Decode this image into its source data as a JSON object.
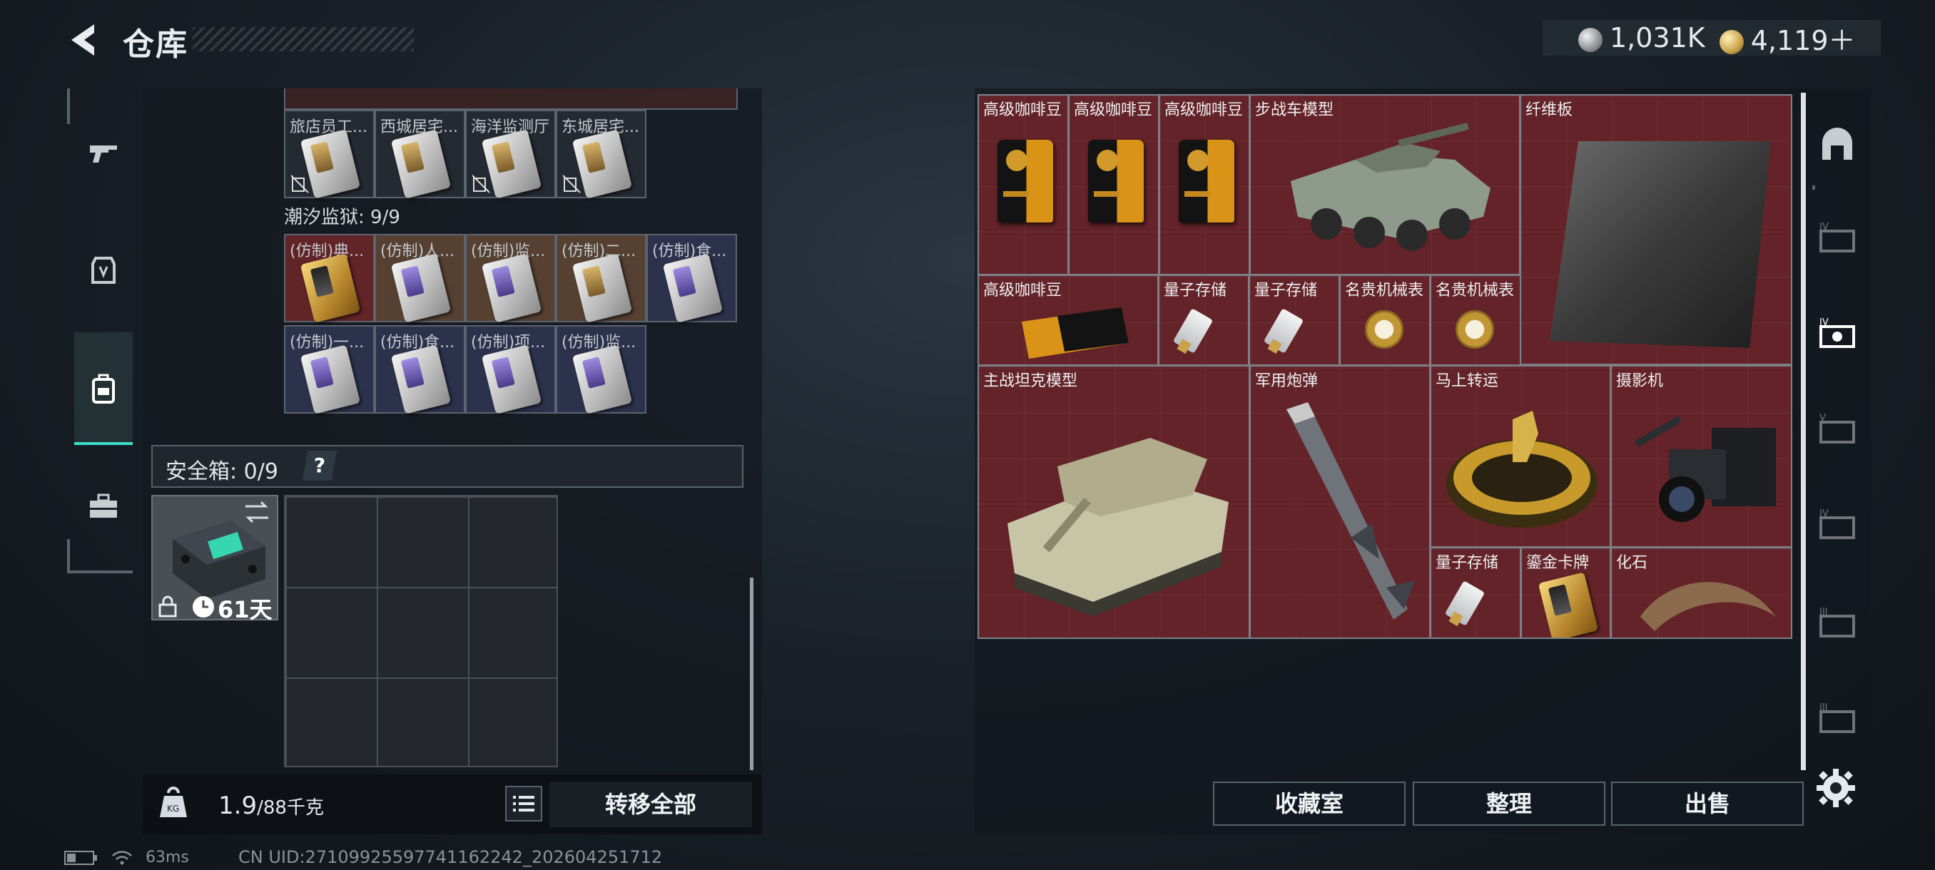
{
  "header": {
    "title": "仓库",
    "currency": [
      {
        "icon": "silver-coin-icon",
        "value": "1,031K"
      },
      {
        "icon": "gold-coin-icon",
        "value": "4,119＋"
      }
    ]
  },
  "nav": {
    "items": [
      {
        "name": "weapon",
        "icon": "gun-icon"
      },
      {
        "name": "armor",
        "icon": "armor-icon"
      },
      {
        "name": "backpack",
        "icon": "backpack-icon",
        "selected": true
      },
      {
        "name": "toolbox",
        "icon": "toolbox-icon"
      }
    ]
  },
  "inventory": {
    "upper_row": [
      {
        "label": "旅店员工..."
      },
      {
        "label": "西城居宅..."
      },
      {
        "label": "海洋监测厅"
      },
      {
        "label": "东城居宅..."
      }
    ],
    "section_label": "潮汐监狱: 9/9",
    "section_items": [
      {
        "label": "(仿制)典..."
      },
      {
        "label": "(仿制)人..."
      },
      {
        "label": "(仿制)监..."
      },
      {
        "label": "(仿制)二..."
      },
      {
        "label": "(仿制)食..."
      },
      {
        "label": "(仿制)一..."
      },
      {
        "label": "(仿制)食..."
      },
      {
        "label": "(仿制)项..."
      },
      {
        "label": "(仿制)监..."
      }
    ],
    "safebox": {
      "label": "安全箱: 0/9",
      "help": "?",
      "days": "61天"
    },
    "weight": {
      "value": "1.9",
      "unit": "/88千克"
    },
    "transfer_all": "转移全部"
  },
  "stash": {
    "items": [
      {
        "label": "高级咖啡豆"
      },
      {
        "label": "高级咖啡豆"
      },
      {
        "label": "高级咖啡豆"
      },
      {
        "label": "步战车模型"
      },
      {
        "label": "纤维板"
      },
      {
        "label": "高级咖啡豆"
      },
      {
        "label": "量子存储"
      },
      {
        "label": "量子存储"
      },
      {
        "label": "名贵机械表"
      },
      {
        "label": "名贵机械表"
      },
      {
        "label": "主战坦克模型"
      },
      {
        "label": "军用炮弹"
      },
      {
        "label": "马上转运"
      },
      {
        "label": "摄影机"
      },
      {
        "label": "量子存储"
      },
      {
        "label": "鎏金卡牌"
      },
      {
        "label": "化石"
      }
    ],
    "side_tabs": [
      {
        "icon": "home-arch-icon"
      },
      {
        "icon": "tier-iv-case-icon",
        "tier": "IV"
      },
      {
        "icon": "tier-iv-case-icon",
        "tier": "IV",
        "selected": true
      },
      {
        "icon": "tier-v-case-icon",
        "tier": "V"
      },
      {
        "icon": "tier-iv-case-icon",
        "tier": "IV"
      },
      {
        "icon": "tier-iii-case-icon",
        "tier": "III"
      },
      {
        "icon": "tier-iii-case-icon",
        "tier": "III"
      }
    ],
    "buttons": {
      "collection": "收藏室",
      "sort": "整理",
      "sell": "出售"
    }
  },
  "status": {
    "ping": "63ms",
    "uid": "CN UID:2710992559774116224​2_202604251712"
  }
}
